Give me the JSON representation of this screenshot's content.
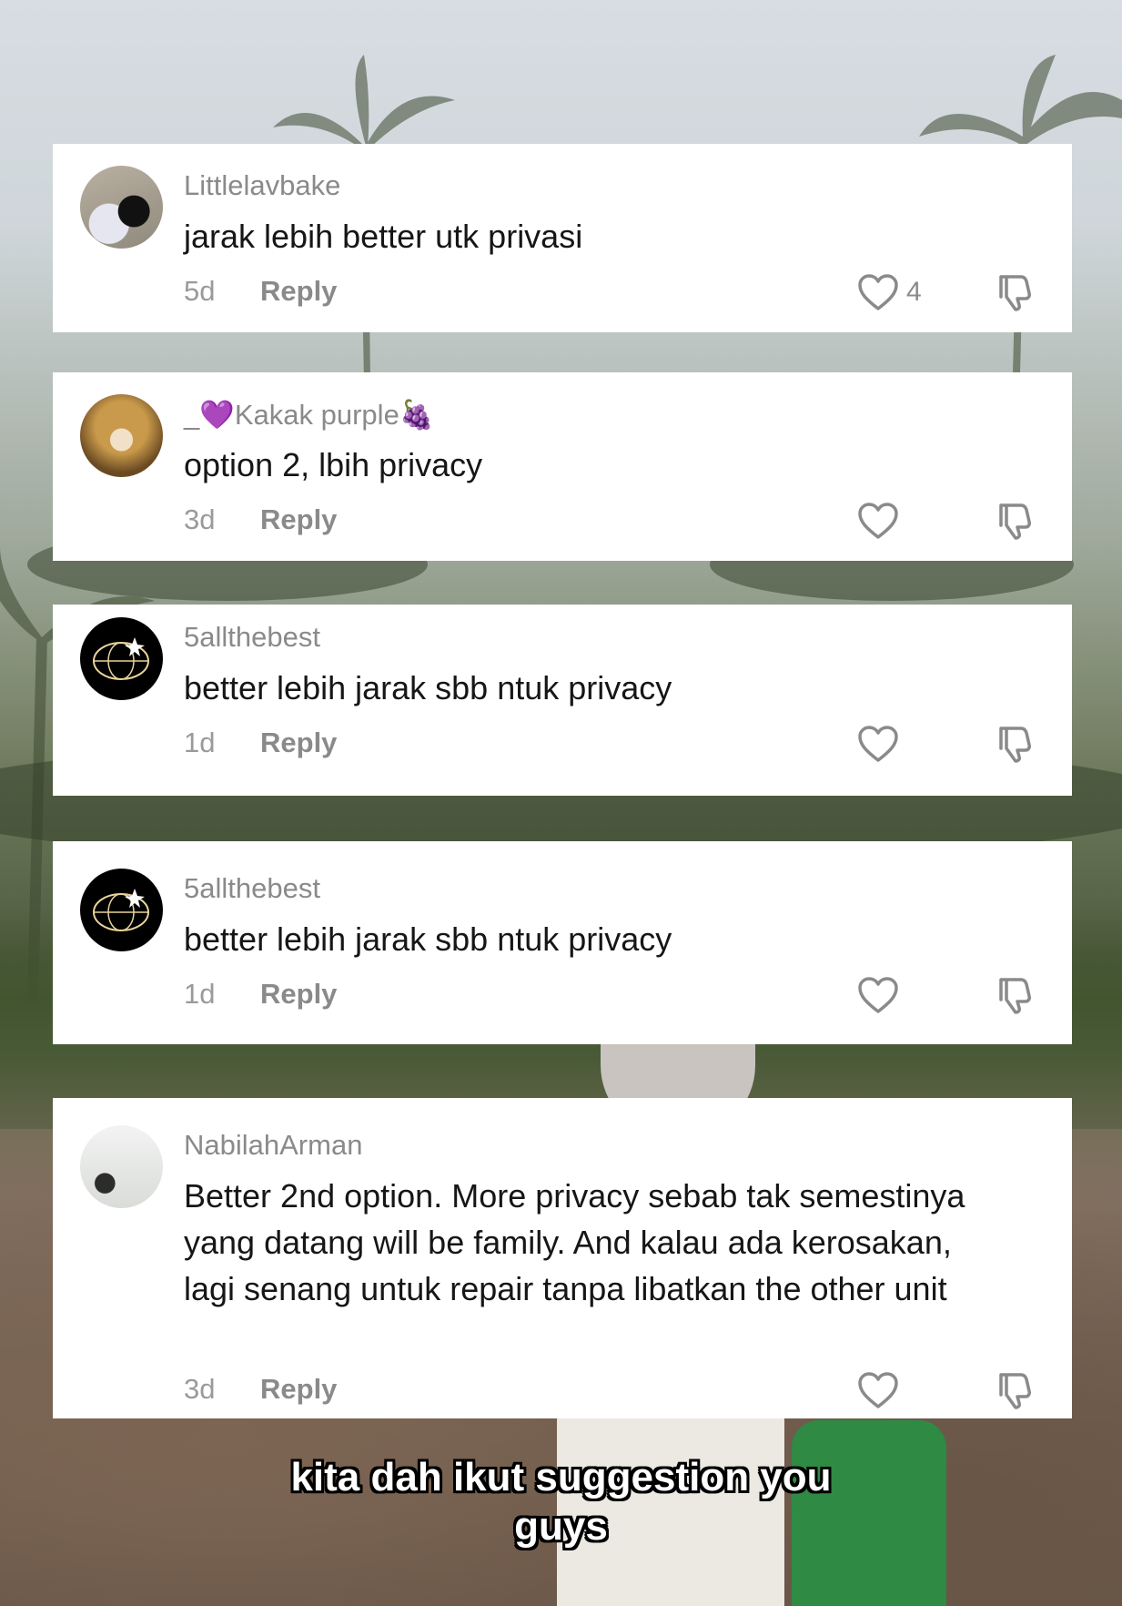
{
  "comments": [
    {
      "username": "Littlelavbake",
      "text": "jarak lebih better utk privasi",
      "time": "5d",
      "reply": "Reply",
      "likes": "4"
    },
    {
      "username_prefix": "_",
      "username_main": "Kakak purple",
      "username_emoji_heart": "💜",
      "username_emoji_grapes": "🍇",
      "text": "option 2, lbih privacy",
      "time": "3d",
      "reply": "Reply"
    },
    {
      "username": "5allthebest",
      "text": "better lebih jarak sbb ntuk privacy",
      "time": "1d",
      "reply": "Reply"
    },
    {
      "username": "5allthebest",
      "text": "better lebih jarak sbb ntuk privacy",
      "time": "1d",
      "reply": "Reply"
    },
    {
      "username": "NabilahArman",
      "text": "Better 2nd option. More privacy sebab tak semestinya yang datang will be family. And kalau ada kerosakan, lagi senang untuk repair tanpa libatkan the other unit",
      "time": "3d",
      "reply": "Reply"
    }
  ],
  "caption": {
    "line1": "kita dah ikut suggestion you",
    "line2": "guys"
  },
  "icons": {
    "like": "heart-outline-icon",
    "dislike": "thumbs-down-icon"
  },
  "colors": {
    "card": "#ffffff",
    "username": "#8a8a8a",
    "text": "#161616",
    "caption": "#ffffff"
  }
}
